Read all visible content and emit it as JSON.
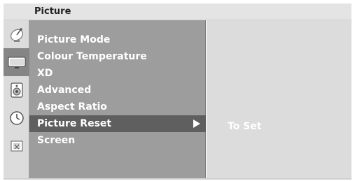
{
  "title": "Picture",
  "sidebar": {
    "icons": [
      {
        "name": "satellite-dish-icon",
        "active": false
      },
      {
        "name": "tv-screen-icon",
        "active": true
      },
      {
        "name": "speaker-icon",
        "active": false
      },
      {
        "name": "clock-icon",
        "active": false
      },
      {
        "name": "lock-icon",
        "active": false
      }
    ]
  },
  "menu": {
    "items": [
      {
        "label": "Picture Mode"
      },
      {
        "label": "Colour Temperature"
      },
      {
        "label": "XD"
      },
      {
        "label": "Advanced"
      },
      {
        "label": "Aspect Ratio"
      },
      {
        "label": "Picture Reset",
        "selected": true,
        "has_submenu": true
      },
      {
        "label": "Screen"
      }
    ]
  },
  "submenu": {
    "label": "To Set"
  },
  "colors": {
    "menu_bg": "#9d9d9d",
    "selected_bg": "#5f5f5f",
    "text": "#ffffff",
    "sidebar_bg": "#dcdcdc"
  }
}
